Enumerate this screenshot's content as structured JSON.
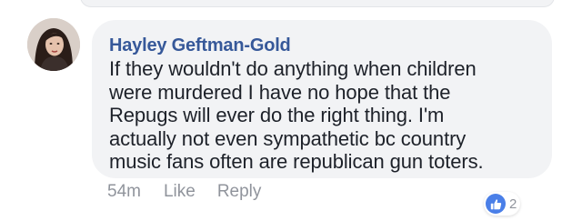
{
  "comment": {
    "author": "Hayley Geftman-Gold",
    "text": "If they wouldn't do anything when children\nwere murdered I have no hope that the\nRepugs will ever do the right thing.  I'm\nactually not even sympathetic bc country\nmusic fans often are republican gun toters.",
    "timestamp": "54m",
    "like_label": "Like",
    "reply_label": "Reply",
    "reaction_icon": "thumbs-up-icon",
    "reaction_count": "2"
  },
  "colors": {
    "author_link": "#365899",
    "bubble_bg": "#f2f3f5",
    "meta_text": "#90949c",
    "like_blue": "#4a7fe8"
  }
}
